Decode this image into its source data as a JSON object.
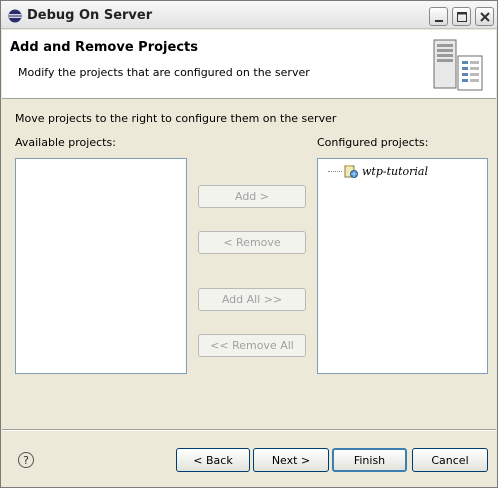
{
  "window": {
    "title": "Debug On Server"
  },
  "banner": {
    "title": "Add and Remove Projects",
    "description": "Modify the projects that are configured on the server"
  },
  "main": {
    "instruction": "Move projects to the right to configure them on the server",
    "available_label": "Available projects:",
    "configured_label": "Configured projects:",
    "available_projects": [],
    "configured_projects": [
      {
        "name": "wtp-tutorial",
        "icon": "web-project-icon"
      }
    ]
  },
  "transfer_buttons": {
    "add": "Add >",
    "remove": "< Remove",
    "add_all": "Add All >>",
    "remove_all": "<< Remove All"
  },
  "footer": {
    "help": "?",
    "back": "< Back",
    "next": "Next >",
    "finish": "Finish",
    "cancel": "Cancel"
  },
  "colors": {
    "list_border": "#7f9db9",
    "dialog_bg": "#ece9d8",
    "default_button_border": "#3c7fb1"
  }
}
